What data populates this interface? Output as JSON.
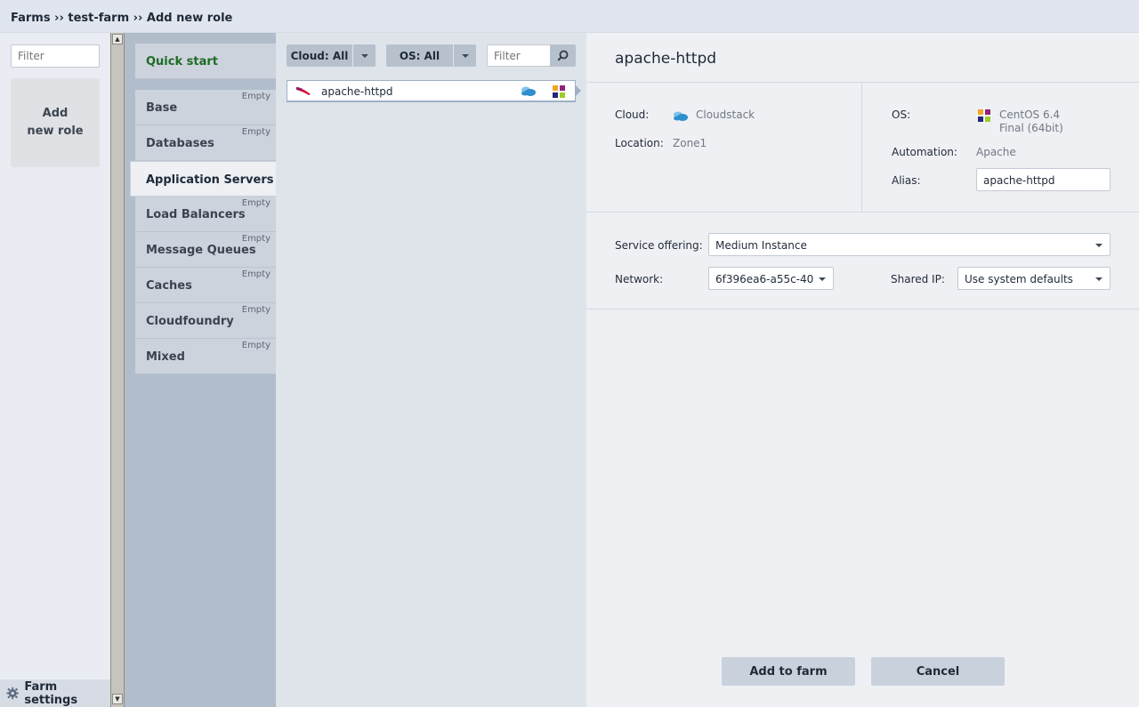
{
  "breadcrumb": {
    "items": [
      "Farms",
      "test-farm",
      "Add new role"
    ],
    "separator": "››"
  },
  "roles_panel": {
    "filter_placeholder": "Filter",
    "add_role_line1": "Add",
    "add_role_line2": "new role",
    "farm_settings": "Farm settings"
  },
  "categories": {
    "quick_start": "Quick start",
    "items": [
      {
        "label": "Base",
        "badge": "Empty"
      },
      {
        "label": "Databases",
        "badge": "Empty"
      },
      {
        "label": "Application Servers",
        "badge": ""
      },
      {
        "label": "Load Balancers",
        "badge": "Empty"
      },
      {
        "label": "Message Queues",
        "badge": "Empty"
      },
      {
        "label": "Caches",
        "badge": "Empty"
      },
      {
        "label": "Cloudfoundry",
        "badge": "Empty"
      },
      {
        "label": "Mixed",
        "badge": "Empty"
      }
    ],
    "active": "Application Servers"
  },
  "role_list": {
    "cloud_filter": "Cloud: All",
    "os_filter": "OS: All",
    "filter_placeholder": "Filter",
    "roles": [
      {
        "name": "apache-httpd",
        "cloud_icon": "cloudstack-icon",
        "os_icon": "centos-icon"
      }
    ]
  },
  "details": {
    "title": "apache-httpd",
    "cloud_label": "Cloud:",
    "cloud_value": "Cloudstack",
    "location_label": "Location:",
    "location_value": "Zone1",
    "os_label": "OS:",
    "os_value_line1": "CentOS 6.4",
    "os_value_line2": "Final (64bit)",
    "automation_label": "Automation:",
    "automation_value": "Apache",
    "alias_label": "Alias:",
    "alias_value": "apache-httpd",
    "service_offering_label": "Service offering:",
    "service_offering_value": "Medium Instance",
    "network_label": "Network:",
    "network_value": "6f396ea6-a55c-40",
    "shared_ip_label": "Shared IP:",
    "shared_ip_value": "Use system defaults",
    "add_button": "Add to farm",
    "cancel_button": "Cancel"
  },
  "colors": {
    "quick_start_green": "#1d6b26",
    "category_panel": "#b1bdcb",
    "button": "#c9d1dd",
    "cloud_icon_blue": "#2f8fce"
  }
}
